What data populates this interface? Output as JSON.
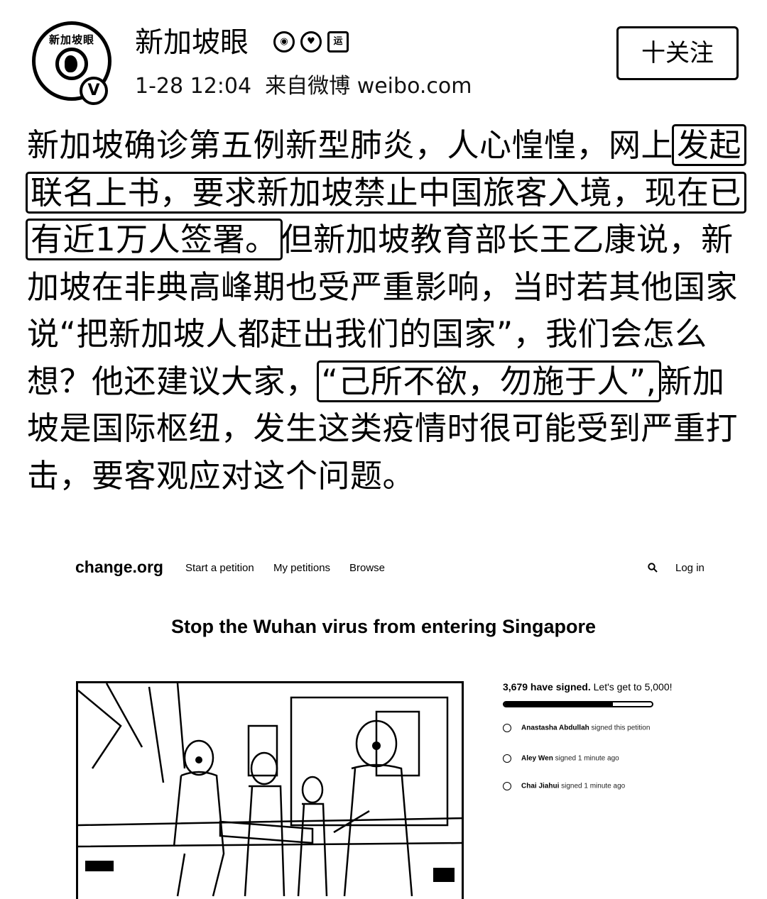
{
  "weibo": {
    "avatar_text": "新加坡眼",
    "verified_mark": "V",
    "username": "新加坡眼",
    "badges": [
      "eye",
      "vip",
      "运"
    ],
    "timestamp": "1-28 12:04",
    "source": "来自微博 weibo.com",
    "follow_label": "十关注"
  },
  "post": {
    "s1": "新加坡确诊第五例新型肺炎，人心惶惶，网上",
    "h1": "发起联名上书，要求新加坡禁止中国旅客入境，现在已有近1万人签署。",
    "s2": "但新加坡教育部长王乙康说，新加坡在非典高峰期也受严重影响，当时若其他国家说“把新加坡人都赶出我们的国家”，我们会怎么想？他还建议大家，",
    "h2": "“己所不欲，勿施于人”,",
    "s3": "新加坡是国际枢纽，发生这类疫情时很可能受到严重打击，要客观应对这个问题。"
  },
  "changeorg": {
    "logo": "change.org",
    "nav": [
      "Start a petition",
      "My petitions",
      "Browse"
    ],
    "login": "Log in",
    "title": "Stop the Wuhan virus from entering Singapore",
    "signed_count": "3,679 have signed.",
    "goal_text": "Let's get to 5,000!",
    "progress_fraction": 0.7358,
    "signers": [
      {
        "name": "Anastasha Abdullah",
        "action": "signed this petition"
      },
      {
        "name": "Aley Wen",
        "action": "signed 1 minute ago"
      },
      {
        "name": "Chai Jiahui",
        "action": "signed 1 minute ago"
      }
    ]
  }
}
